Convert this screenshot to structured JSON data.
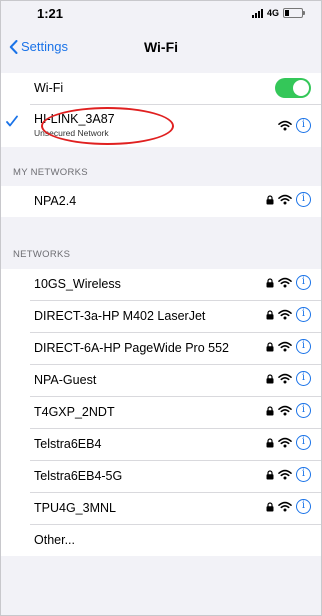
{
  "status_bar": {
    "time": "1:21",
    "network": "4G"
  },
  "nav": {
    "back_label": "Settings",
    "title": "Wi-Fi"
  },
  "wifi_toggle": {
    "label": "Wi-Fi",
    "on": true
  },
  "connected": {
    "name": "HI-LINK_3A87",
    "subtitle": "Unsecured Network"
  },
  "sections": {
    "my_networks": "MY NETWORKS",
    "networks": "NETWORKS"
  },
  "my_networks": [
    {
      "name": "NPA2.4",
      "locked": true
    }
  ],
  "networks": [
    {
      "name": "10GS_Wireless",
      "locked": true
    },
    {
      "name": "DIRECT-3a-HP M402 LaserJet",
      "locked": true
    },
    {
      "name": "DIRECT-6A-HP PageWide Pro 552",
      "locked": true
    },
    {
      "name": "NPA-Guest",
      "locked": true
    },
    {
      "name": "T4GXP_2NDT",
      "locked": true
    },
    {
      "name": "Telstra6EB4",
      "locked": true
    },
    {
      "name": "Telstra6EB4-5G",
      "locked": true
    },
    {
      "name": "TPU4G_3MNL",
      "locked": true
    }
  ],
  "other_label": "Other...",
  "info_glyph": "i",
  "colors": {
    "accent": "#1a73e8",
    "toggle_on": "#34c759",
    "annotation": "#e02020"
  }
}
